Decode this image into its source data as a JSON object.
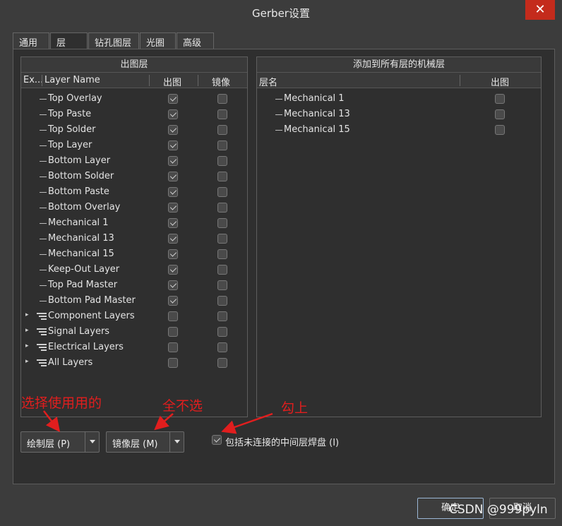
{
  "window": {
    "title": "Gerber设置",
    "close_symbol": "✕"
  },
  "tabs": [
    "通用",
    "层",
    "钻孔图层",
    "光圈",
    "高级"
  ],
  "left_panel": {
    "header": "出图层",
    "columns": {
      "expand": "Ex...",
      "name": "Layer Name",
      "plot": "出图",
      "mirror": "镜像"
    },
    "layers": [
      {
        "name": "Top Overlay",
        "plot": true,
        "mirror": false
      },
      {
        "name": "Top Paste",
        "plot": true,
        "mirror": false
      },
      {
        "name": "Top Solder",
        "plot": true,
        "mirror": false
      },
      {
        "name": "Top Layer",
        "plot": true,
        "mirror": false
      },
      {
        "name": "Bottom Layer",
        "plot": true,
        "mirror": false
      },
      {
        "name": "Bottom Solder",
        "plot": true,
        "mirror": false
      },
      {
        "name": "Bottom Paste",
        "plot": true,
        "mirror": false
      },
      {
        "name": "Bottom Overlay",
        "plot": true,
        "mirror": false
      },
      {
        "name": "Mechanical 1",
        "plot": true,
        "mirror": false
      },
      {
        "name": "Mechanical 13",
        "plot": true,
        "mirror": false
      },
      {
        "name": "Mechanical 15",
        "plot": true,
        "mirror": false
      },
      {
        "name": "Keep-Out Layer",
        "plot": true,
        "mirror": false
      },
      {
        "name": "Top Pad Master",
        "plot": true,
        "mirror": false
      },
      {
        "name": "Bottom Pad Master",
        "plot": true,
        "mirror": false
      }
    ],
    "groups": [
      {
        "name": "Component Layers",
        "plot": false,
        "mirror": false
      },
      {
        "name": "Signal Layers",
        "plot": false,
        "mirror": false
      },
      {
        "name": "Electrical Layers",
        "plot": false,
        "mirror": false
      },
      {
        "name": "All Layers",
        "plot": false,
        "mirror": false
      }
    ]
  },
  "right_panel": {
    "header": "添加到所有层的机械层",
    "columns": {
      "name": "层名",
      "plot": "出图"
    },
    "layers": [
      {
        "name": "Mechanical 1",
        "plot": false
      },
      {
        "name": "Mechanical 13",
        "plot": false
      },
      {
        "name": "Mechanical 15",
        "plot": false
      }
    ]
  },
  "buttons": {
    "plot_layers": "绘制层 (P)",
    "mirror_layers": "镜像层 (M)",
    "ok": "确定",
    "cancel": "取消"
  },
  "include_unconnected": {
    "label": "包括未连接的中间层焊盘 (I)",
    "checked": true
  },
  "annotations": {
    "select_used": "选择使用用的",
    "select_none": "全不选",
    "check_it": "勾上"
  },
  "watermark": "CSDN @999pyln",
  "colors": {
    "annotation": "#e11e1e",
    "close_button": "#c42b1c"
  }
}
